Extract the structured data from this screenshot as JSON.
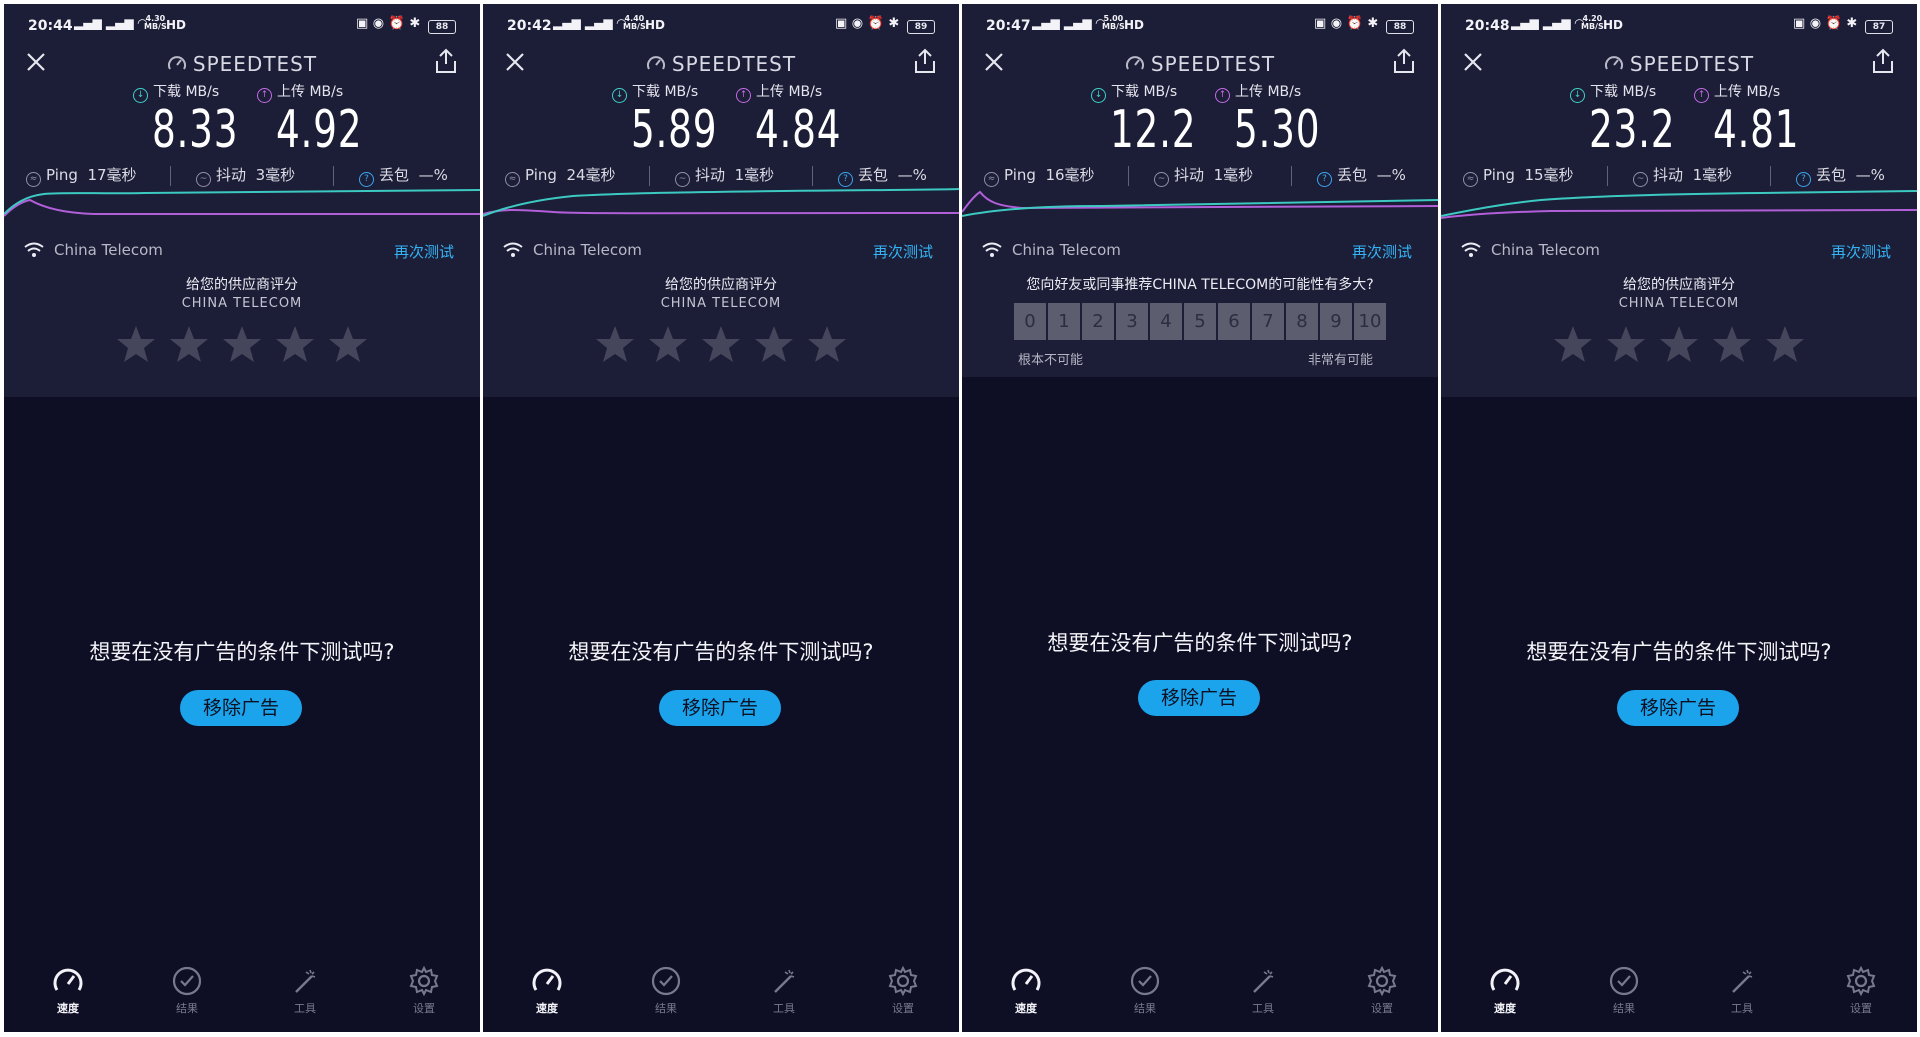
{
  "screens": [
    {
      "status": {
        "time": "20:44",
        "net_speed": "4.30",
        "net_unit": "MB/S",
        "hd": "HD",
        "battery": "88"
      },
      "brand": "SPEEDTEST",
      "download_label": "下载 MB/s",
      "upload_label": "上传 MB/s",
      "download": "8.33",
      "upload": "4.92",
      "ping_label": "Ping",
      "ping": "17毫秒",
      "jitter_label": "抖动",
      "jitter": "3毫秒",
      "loss_label": "丢包",
      "loss": "—%",
      "isp": "China Telecom",
      "retest": "再次测试",
      "rating_title": "给您的供应商评分",
      "rating_sub": "CHINA TELECOM",
      "stars": 5,
      "ad_question": "想要在没有广告的条件下测试吗?",
      "ad_button": "移除广告",
      "tabs": [
        "速度",
        "结果",
        "工具",
        "设置"
      ]
    },
    {
      "status": {
        "time": "20:42",
        "net_speed": "4.40",
        "net_unit": "MB/S",
        "hd": "HD",
        "battery": "89"
      },
      "brand": "SPEEDTEST",
      "download_label": "下载 MB/s",
      "upload_label": "上传 MB/s",
      "download": "5.89",
      "upload": "4.84",
      "ping_label": "Ping",
      "ping": "24毫秒",
      "jitter_label": "抖动",
      "jitter": "1毫秒",
      "loss_label": "丢包",
      "loss": "—%",
      "isp": "China Telecom",
      "retest": "再次测试",
      "rating_title": "给您的供应商评分",
      "rating_sub": "CHINA TELECOM",
      "stars": 5,
      "ad_question": "想要在没有广告的条件下测试吗?",
      "ad_button": "移除广告",
      "tabs": [
        "速度",
        "结果",
        "工具",
        "设置"
      ]
    },
    {
      "status": {
        "time": "20:47",
        "net_speed": "5.00",
        "net_unit": "MB/S",
        "hd": "HD",
        "battery": "88"
      },
      "brand": "SPEEDTEST",
      "download_label": "下载 MB/s",
      "upload_label": "上传 MB/s",
      "download": "12.2",
      "upload": "5.30",
      "ping_label": "Ping",
      "ping": "16毫秒",
      "jitter_label": "抖动",
      "jitter": "1毫秒",
      "loss_label": "丢包",
      "loss": "—%",
      "isp": "China Telecom",
      "retest": "再次测试",
      "nps_question": "您向好友或同事推荐CHINA TELECOM的可能性有多大?",
      "nps_scale": [
        "0",
        "1",
        "2",
        "3",
        "4",
        "5",
        "6",
        "7",
        "8",
        "9",
        "10"
      ],
      "nps_low": "根本不可能",
      "nps_high": "非常有可能",
      "ad_question": "想要在没有广告的条件下测试吗?",
      "ad_button": "移除广告",
      "tabs": [
        "速度",
        "结果",
        "工具",
        "设置"
      ]
    },
    {
      "status": {
        "time": "20:48",
        "net_speed": "4.20",
        "net_unit": "MB/S",
        "hd": "HD",
        "battery": "87"
      },
      "brand": "SPEEDTEST",
      "download_label": "下载 MB/s",
      "upload_label": "上传 MB/s",
      "download": "23.2",
      "upload": "4.81",
      "ping_label": "Ping",
      "ping": "15毫秒",
      "jitter_label": "抖动",
      "jitter": "1毫秒",
      "loss_label": "丢包",
      "loss": "—%",
      "isp": "China Telecom",
      "retest": "再次测试",
      "rating_title": "给您的供应商评分",
      "rating_sub": "CHINA TELECOM",
      "stars": 5,
      "ad_question": "想要在没有广告的条件下测试吗?",
      "ad_button": "移除广告",
      "tabs": [
        "速度",
        "结果",
        "工具",
        "设置"
      ]
    }
  ],
  "colors": {
    "download": "#3fd1c8",
    "upload": "#c46ce6",
    "accent": "#1ba4ec",
    "link": "#34b3f5",
    "bg": "#0e0f24",
    "panel": "#1c1d36"
  },
  "icons": [
    "close-icon",
    "speedtest-logo-icon",
    "share-icon",
    "download-icon",
    "upload-icon",
    "ping-icon",
    "jitter-icon",
    "packet-loss-icon",
    "wifi-icon",
    "star-icon",
    "speedometer-icon",
    "check-circle-icon",
    "magic-wand-icon",
    "gear-icon"
  ]
}
